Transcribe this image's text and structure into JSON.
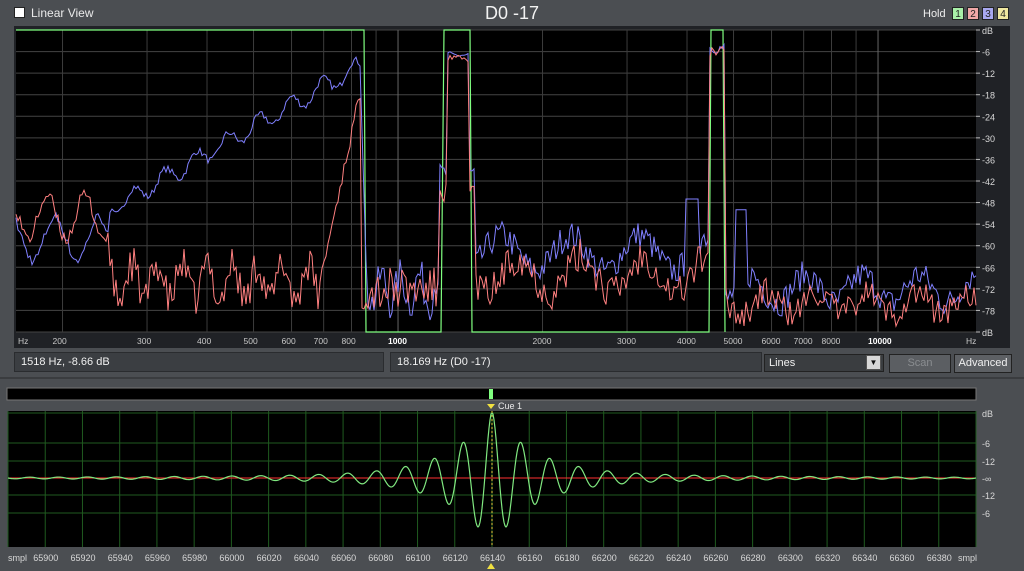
{
  "header": {
    "linear_view_label": "Linear View",
    "title": "D0 -17",
    "hold_label": "Hold",
    "hold_buttons": [
      "1",
      "2",
      "3",
      "4"
    ]
  },
  "spectrum": {
    "db_ticks": [
      "dB",
      "-6",
      "-12",
      "-18",
      "-24",
      "-30",
      "-36",
      "-42",
      "-48",
      "-54",
      "-60",
      "-66",
      "-72",
      "-78",
      "dB"
    ],
    "freq_ticks": [
      {
        "label": "Hz"
      },
      {
        "label": "200"
      },
      {
        "label": "300"
      },
      {
        "label": "400"
      },
      {
        "label": "500"
      },
      {
        "label": "600"
      },
      {
        "label": "700"
      },
      {
        "label": "800"
      },
      {
        "label": "1000"
      },
      {
        "label": "2000"
      },
      {
        "label": "3000"
      },
      {
        "label": "4000"
      },
      {
        "label": "5000"
      },
      {
        "label": "6000"
      },
      {
        "label": "7000"
      },
      {
        "label": "8000"
      },
      {
        "label": "10000"
      },
      {
        "label": "Hz"
      }
    ],
    "colors": {
      "background": "#000000",
      "grid": "#555555",
      "blue": "#8080ff",
      "red": "#ff8080",
      "green": "#80ff80"
    }
  },
  "status": {
    "cursor_readout": "1518 Hz,  -8.66 dB",
    "selection_readout": "18.169 Hz (D0 -17)",
    "view_mode": "Lines",
    "scan_label": "Scan",
    "advanced_label": "Advanced"
  },
  "overview": {
    "cue_label": "Cue 1",
    "db_ticks": [
      "dB",
      "-6",
      "-12",
      "-∞",
      "-12",
      "-6"
    ],
    "sample_ticks": [
      "smpl",
      "65900",
      "65920",
      "65940",
      "65960",
      "65980",
      "66000",
      "66020",
      "66040",
      "66060",
      "66080",
      "66100",
      "66120",
      "66140",
      "66160",
      "66180",
      "66200",
      "66220",
      "66240",
      "66260",
      "66280",
      "66300",
      "66320",
      "66340",
      "66360",
      "66380",
      "smpl"
    ],
    "colors": {
      "wave": "#80e880",
      "center_line": "#ff4040",
      "cursor": "#e8d840"
    }
  }
}
